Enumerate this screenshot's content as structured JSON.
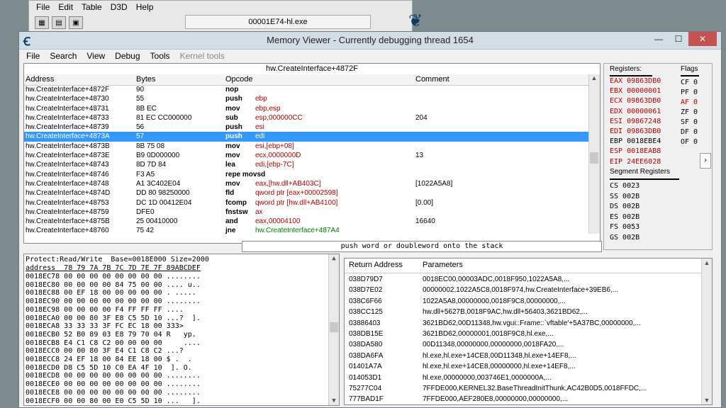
{
  "bg_window": {
    "menu": [
      "File",
      "Edit",
      "Table",
      "D3D",
      "Help"
    ],
    "process_title": "00001E74-hl.exe"
  },
  "window": {
    "title": "Memory Viewer - Currently debugging thread 1654",
    "menu": [
      "File",
      "Search",
      "View",
      "Debug",
      "Tools",
      "Kernel tools"
    ]
  },
  "disasm": {
    "location": "hw.CreateInterface+4872F",
    "headers": {
      "address": "Address",
      "bytes": "Bytes",
      "opcode": "Opcode",
      "comment": "Comment"
    },
    "rows": [
      {
        "address": "hw.CreateInterface+4872F",
        "bytes": "90",
        "op": "nop",
        "arg": "",
        "comment": ""
      },
      {
        "address": "hw.CreateInterface+48730",
        "bytes": "55",
        "op": "push",
        "arg": "ebp",
        "comment": ""
      },
      {
        "address": "hw.CreateInterface+48731",
        "bytes": "8B EC",
        "op": "mov",
        "arg": "ebp,esp",
        "comment": ""
      },
      {
        "address": "hw.CreateInterface+48733",
        "bytes": "81 EC CC000000",
        "op": "sub",
        "arg": "esp,000000CC",
        "comment": "204"
      },
      {
        "address": "hw.CreateInterface+48739",
        "bytes": "56",
        "op": "push",
        "arg": "esi",
        "comment": ""
      },
      {
        "address": "hw.CreateInterface+4873A",
        "bytes": "57",
        "op": "push",
        "arg": "edi",
        "comment": ""
      },
      {
        "address": "hw.CreateInterface+4873B",
        "bytes": "8B 75 08",
        "op": "mov",
        "arg": "esi,[ebp+08]",
        "comment": ""
      },
      {
        "address": "hw.CreateInterface+4873E",
        "bytes": "B9 0D000000",
        "op": "mov",
        "arg": "ecx,0000000D",
        "comment": "13"
      },
      {
        "address": "hw.CreateInterface+48743",
        "bytes": "8D 7D 84",
        "op": "lea",
        "arg": "edi,[ebp-7C]",
        "comment": ""
      },
      {
        "address": "hw.CreateInterface+48746",
        "bytes": "F3 A5",
        "op": "repe movsd",
        "arg": "",
        "comment": ""
      },
      {
        "address": "hw.CreateInterface+48748",
        "bytes": "A1 3C402E04",
        "op": "mov",
        "arg": "eax,[hw.dll+AB403C]",
        "comment": "[1022A5A8]"
      },
      {
        "address": "hw.CreateInterface+4874D",
        "bytes": "DD 80 98250000",
        "op": "fld",
        "arg": "qword ptr [eax+00002598]",
        "comment": ""
      },
      {
        "address": "hw.CreateInterface+48753",
        "bytes": "DC 1D 00412E04",
        "op": "fcomp",
        "arg": "qword ptr [hw.dll+AB4100]",
        "comment": "[0.00]"
      },
      {
        "address": "hw.CreateInterface+48759",
        "bytes": "DFE0",
        "op": "fnstsw",
        "arg": "ax",
        "comment": ""
      },
      {
        "address": "hw.CreateInterface+4875B",
        "bytes": "25 00410000",
        "op": "and",
        "arg": "eax,00004100",
        "comment": "16640"
      },
      {
        "address": "hw.CreateInterface+48760",
        "bytes": "75 42",
        "op": "jne",
        "arg": "hw.CreateInterface+487A4",
        "comment": ""
      }
    ],
    "selected_index": 5,
    "hint": "push word or doubleword onto the stack"
  },
  "registers": {
    "header": "Registers:",
    "flags_header": "Flags",
    "regs": [
      {
        "text": "EAX 09863DB0",
        "changed": true
      },
      {
        "text": "EBX 00000001",
        "changed": true
      },
      {
        "text": "ECX 09863DB0",
        "changed": true
      },
      {
        "text": "EDX 00000061",
        "changed": true
      },
      {
        "text": "ESI 09867248",
        "changed": true
      },
      {
        "text": "EDI 09863DB0",
        "changed": true
      },
      {
        "text": "EBP 0018EBE4",
        "changed": false
      },
      {
        "text": "ESP 0018EAB8",
        "changed": true
      },
      {
        "text": "EIP 24EE6028",
        "changed": true
      }
    ],
    "flags": [
      {
        "text": "CF 0",
        "changed": false
      },
      {
        "text": "PF 0",
        "changed": false
      },
      {
        "text": "AF 0",
        "changed": true
      },
      {
        "text": "ZF 0",
        "changed": false
      },
      {
        "text": "SF 0",
        "changed": false
      },
      {
        "text": "DF 0",
        "changed": false
      },
      {
        "text": "OF 0",
        "changed": false
      }
    ],
    "segment_header": "Segment Registers",
    "segments": [
      "CS 0023",
      "SS 002B",
      "DS 002B",
      "ES 002B",
      "FS 0053",
      "GS 002B"
    ]
  },
  "hex": {
    "info": "Protect:Read/Write  Base=0018E000 Size=2000",
    "header": "address  78 79 7A 7B 7C 7D 7E 7F 89ABCDEF",
    "lines": [
      "0018EC78 00 00 00 00 00 00 00 00 ........",
      "0018EC80 00 00 00 00 84 75 00 00 .... u..",
      "0018EC88 00 EF 18 00 00 00 00 00 . .....",
      "0018EC90 00 00 00 00 00 00 00 00 ........",
      "0018EC98 00 00 00 00 F4 FF FF FF ....",
      "0018ECA0 00 00 80 3F E8 C5 5D 10 ...?  ].",
      "0018ECA8 33 33 33 3F FC EC 18 00 333>",
      "0018ECB0 52 B0 89 03 E8 79 70 04 R   yp.",
      "0018ECB8 E4 C1 C8 C2 00 00 00 00     ....",
      "0018ECC0 00 00 80 3F E4 C1 C8 C2 ...?",
      "0018ECC8 24 EF 18 00 84 EE 18 00 $ .  .",
      "0018ECD0 D8 C5 5D 10 C0 EA 4F 10  ]. O.",
      "0018ECD8 00 00 00 00 00 00 00 00 ........",
      "0018ECE0 00 00 00 00 00 00 00 00 ........",
      "0018ECE8 00 00 00 00 00 00 00 00 ........",
      "0018ECF0 00 00 80 00 E0 C5 5D 10 ...   ]."
    ]
  },
  "stack": {
    "headers": {
      "ret": "Return Address",
      "params": "Parameters"
    },
    "rows": [
      {
        "ret": "038D79D7",
        "params": "0018EC00,00003ADC,0018F950,1022A5A8,..."
      },
      {
        "ret": "038D7E02",
        "params": "00000002,1022A5C8,0018F974,hw.CreateInterface+39EB6,..."
      },
      {
        "ret": "038C6F66",
        "params": "1022A5A8,00000000,0018F9C8,00000000,..."
      },
      {
        "ret": "038CC125",
        "params": "hw.dll+5627B,0018F9AC,hw.dll+56403,3621BD62,..."
      },
      {
        "ret": "03886403",
        "params": "3621BD62,00D11348,hw.vgui::Frame::`vftable'+5A37BC,00000000,..."
      },
      {
        "ret": "038DB15E",
        "params": "3621BD62,00000001,0018F9C8,hl.exe,..."
      },
      {
        "ret": "038DA580",
        "params": "00D11348,00000000,00000000,0018FA20,..."
      },
      {
        "ret": "038DA6FA",
        "params": "hl.exe,hl.exe+14CE8,00D11348,hl.exe+14EF8,..."
      },
      {
        "ret": "01401A7A",
        "params": "hl.exe,hl.exe+14CE8,00000000,hl.exe+14EF8,..."
      },
      {
        "ret": "014053D1",
        "params": "hl.exe,00000000,003746E1,0000000A,..."
      },
      {
        "ret": "75277C04",
        "params": "7FFDE000,KERNEL32.BaseThreadInitThunk,AC42B0D5,0018FFDC,..."
      },
      {
        "ret": "777BAD1F",
        "params": "7FFDE000,AEF280E8,00000000,00000000,..."
      }
    ]
  },
  "colors": {
    "selection": "#3399ff",
    "changed": "#c00000",
    "green_arg": "#008000",
    "close_button": "#c75050"
  }
}
